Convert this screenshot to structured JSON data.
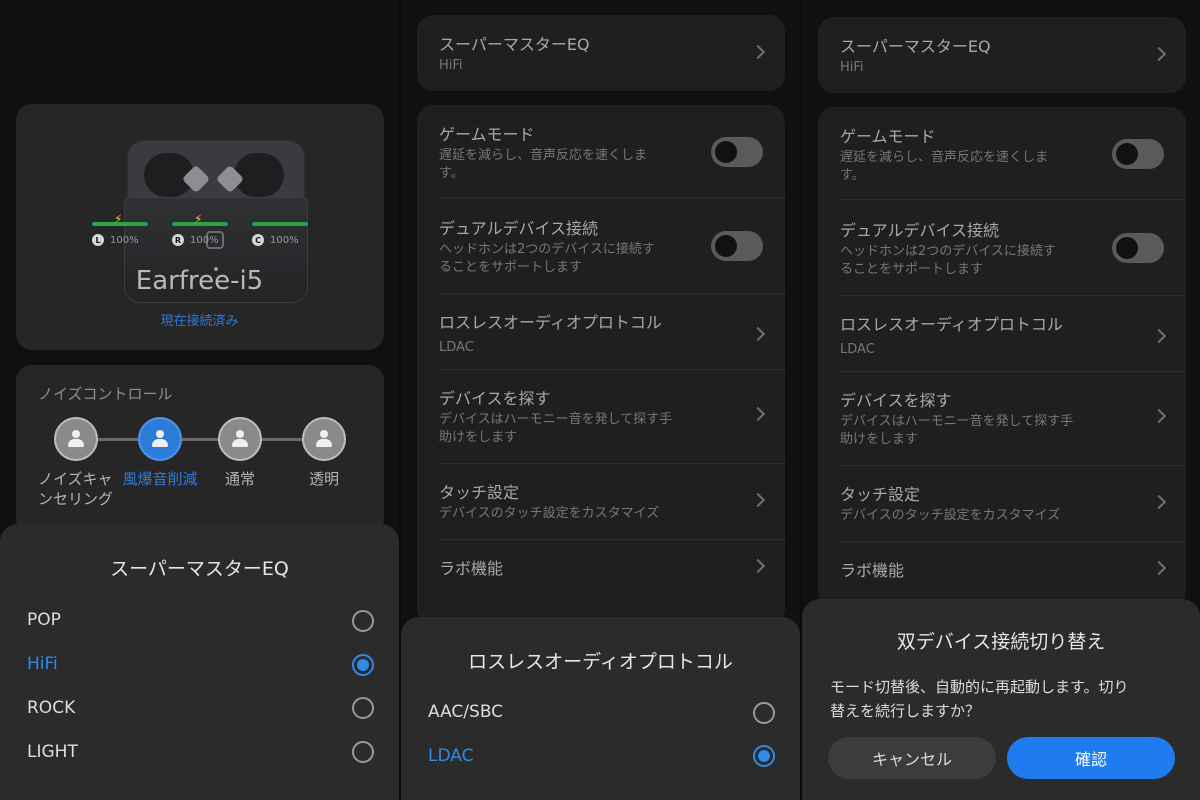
{
  "panel1": {
    "device": {
      "name": "Earfree-i5",
      "status": "現在接続済み",
      "batteries": [
        {
          "letter": "L",
          "percent": "100%",
          "level": 1.0,
          "charging": true
        },
        {
          "letter": "R",
          "percent": "100%",
          "level": 1.0,
          "charging": true
        },
        {
          "letter": "C",
          "percent": "100%",
          "level": 1.0,
          "charging": false
        }
      ]
    },
    "noise_control": {
      "title": "ノイズコントロール",
      "modes": [
        {
          "label": "ノイズキャンセリング",
          "label_l1": "ノイズキャ",
          "label_l2": "ンセリング",
          "active": false
        },
        {
          "label": "風爆音削減",
          "active": true
        },
        {
          "label": "通常",
          "active": false
        },
        {
          "label": "透明",
          "active": false
        }
      ]
    },
    "eq_sheet": {
      "title": "スーパーマスターEQ",
      "options": [
        {
          "label": "POP",
          "selected": false
        },
        {
          "label": "HiFi",
          "selected": true
        },
        {
          "label": "ROCK",
          "selected": false
        },
        {
          "label": "LIGHT",
          "selected": false
        }
      ]
    }
  },
  "settings": {
    "eq": {
      "title": "スーパーマスターEQ",
      "value": "HiFi"
    },
    "game_mode": {
      "title": "ゲームモード",
      "desc_l1": "遅延を減らし、音声反応を速くしま",
      "desc_l2": "す。",
      "enabled": false
    },
    "dual_device": {
      "title": "デュアルデバイス接続",
      "desc_l1": "ヘッドホンは2つのデバイスに接続す",
      "desc_l2": "ることをサポートします",
      "enabled": false
    },
    "lossless": {
      "title": "ロスレスオーディオプロトコル",
      "value": "LDAC"
    },
    "find_device": {
      "title": "デバイスを探す",
      "desc_l1": "デバイスはハーモニー音を発して探す手",
      "desc_l2": "助けをします"
    },
    "touch": {
      "title": "タッチ設定",
      "desc": "デバイスのタッチ設定をカスタマイズ"
    },
    "lab": {
      "title": "ラボ機能"
    }
  },
  "panel2_sheet": {
    "title": "ロスレスオーディオプロトコル",
    "options": [
      {
        "label": "AAC/SBC",
        "selected": false
      },
      {
        "label": "LDAC",
        "selected": true
      }
    ]
  },
  "panel3_dialog": {
    "title": "双デバイス接続切り替え",
    "message_l1": "モード切替後、自動的に再起動します。切り",
    "message_l2": "替えを続行しますか？",
    "cancel_label": "キャンセル",
    "confirm_label": "確認"
  },
  "colors": {
    "accent": "#2f8ae8",
    "battery": "#27a547",
    "sheet": "#2b2b2b",
    "card": "#1f1f1f"
  }
}
